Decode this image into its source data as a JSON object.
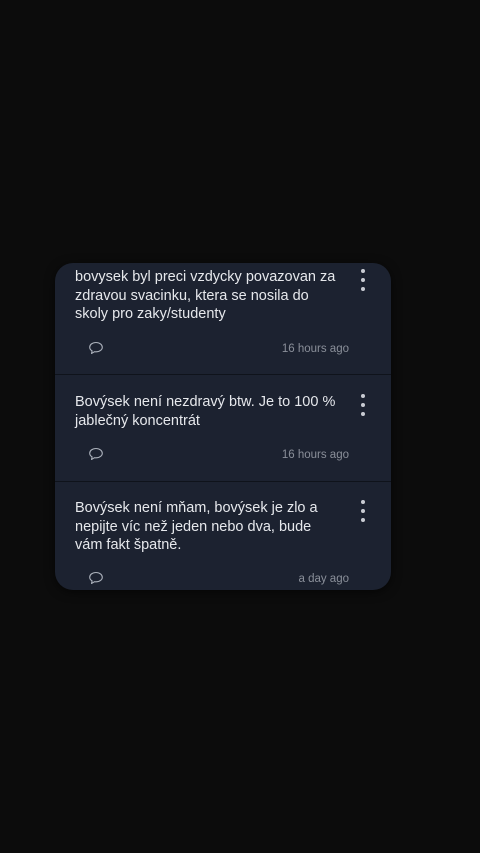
{
  "comments": [
    {
      "text": "bovysek byl preci vzdycky povazovan za zdravou svacinku, ktera se nosila do skoly pro zaky/studenty",
      "time": "16 hours ago",
      "reply_icon": "speech-bubble-icon",
      "menu_icon": "more-vertical-icon"
    },
    {
      "text": "Bovýsek není nezdravý btw. Je to 100 % jablečný koncentrát",
      "time": "16 hours ago",
      "reply_icon": "speech-bubble-icon",
      "menu_icon": "more-vertical-icon"
    },
    {
      "text": "Bovýsek není mňam, bovýsek je zlo a nepijte víc než jeden nebo dva, bude vám fakt špatně.",
      "time": "a day ago",
      "reply_icon": "speech-bubble-icon",
      "menu_icon": "more-vertical-icon"
    }
  ],
  "colors": {
    "background": "#0c0c0c",
    "card": "#1c2230",
    "text": "#e6e8ec",
    "muted": "#8a8f99"
  }
}
